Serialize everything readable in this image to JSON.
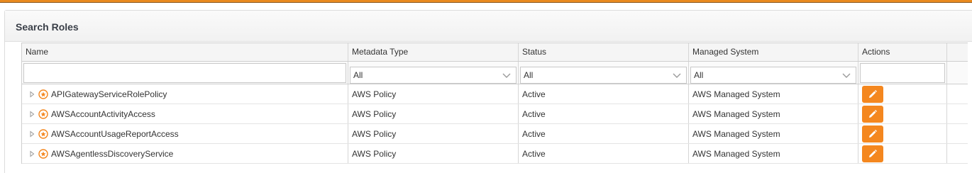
{
  "panel": {
    "title": "Search Roles"
  },
  "grid": {
    "columns": {
      "name": "Name",
      "metadata_type": "Metadata Type",
      "status": "Status",
      "managed_system": "Managed System",
      "actions": "Actions"
    },
    "filters": {
      "name": "",
      "metadata_type": "All",
      "status": "All",
      "managed_system": "All",
      "actions": ""
    },
    "rows": [
      {
        "name": "APIGatewayServiceRolePolicy",
        "metadata_type": "AWS Policy",
        "status": "Active",
        "managed_system": "AWS Managed System"
      },
      {
        "name": "AWSAccountActivityAccess",
        "metadata_type": "AWS Policy",
        "status": "Active",
        "managed_system": "AWS Managed System"
      },
      {
        "name": "AWSAccountUsageReportAccess",
        "metadata_type": "AWS Policy",
        "status": "Active",
        "managed_system": "AWS Managed System"
      },
      {
        "name": "AWSAgentlessDiscoveryService",
        "metadata_type": "AWS Policy",
        "status": "Active",
        "managed_system": "AWS Managed System"
      }
    ]
  },
  "icons": {
    "expander": "triangle-right-icon",
    "policy": "policy-badge-icon",
    "edit": "pencil-icon",
    "dropdown": "chevron-down-icon"
  },
  "colors": {
    "accent": "#f4871f",
    "top_bar": "#e98a1f"
  }
}
